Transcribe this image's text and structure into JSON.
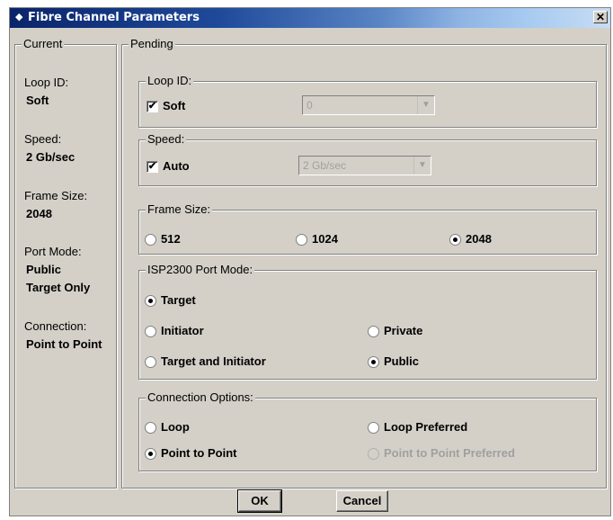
{
  "window": {
    "title": "Fibre Channel Parameters",
    "close_glyph": "✕"
  },
  "current": {
    "legend": "Current",
    "loop_id_label": "Loop ID:",
    "loop_id_value": "Soft",
    "speed_label": "Speed:",
    "speed_value": "2 Gb/sec",
    "frame_size_label": "Frame Size:",
    "frame_size_value": "2048",
    "port_mode_label": "Port Mode:",
    "port_mode_value_1": "Public",
    "port_mode_value_2": "Target Only",
    "connection_label": "Connection:",
    "connection_value": "Point to Point"
  },
  "pending": {
    "legend": "Pending",
    "loop_id": {
      "legend": "Loop ID:",
      "checkbox_label": "Soft",
      "checked": true,
      "combo_value": "0"
    },
    "speed": {
      "legend": "Speed:",
      "checkbox_label": "Auto",
      "checked": true,
      "combo_value": "2 Gb/sec"
    },
    "frame_size": {
      "legend": "Frame Size:",
      "options": [
        "512",
        "1024",
        "2048"
      ],
      "selected": "2048"
    },
    "port_mode": {
      "legend": "ISP2300 Port Mode:",
      "target": "Target",
      "initiator": "Initiator",
      "private": "Private",
      "target_and_initiator": "Target and Initiator",
      "public": "Public"
    },
    "connection": {
      "legend": "Connection Options:",
      "loop": "Loop",
      "loop_preferred": "Loop Preferred",
      "point_to_point": "Point to Point",
      "point_to_point_preferred": "Point to Point Preferred"
    }
  },
  "buttons": {
    "ok": "OK",
    "cancel": "Cancel"
  },
  "icons": {
    "title": "app-icon",
    "close": "close-icon",
    "check": "checkmark-icon",
    "dropdown": "chevron-down-icon"
  }
}
